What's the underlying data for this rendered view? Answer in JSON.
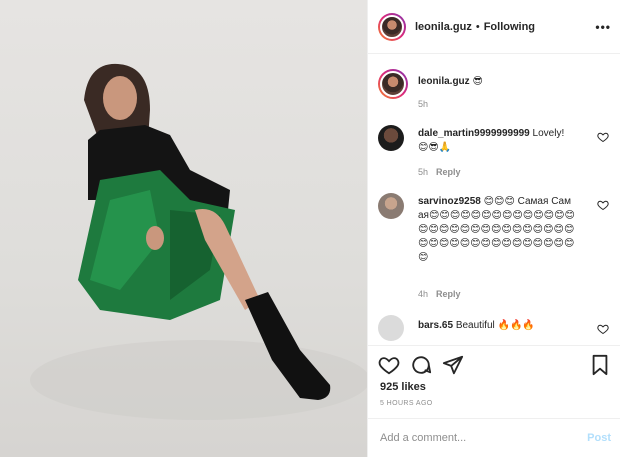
{
  "header": {
    "username": "leonila.guz",
    "dot": "•",
    "following": "Following",
    "more": "•••"
  },
  "caption": {
    "username": "leonila.guz",
    "text": "😎",
    "time": "5h"
  },
  "comments": [
    {
      "username": "dale_martin9999999999",
      "text": "Lovely!",
      "emojis": "😊😎🙏",
      "time": "5h",
      "reply": "Reply"
    },
    {
      "username": "sarvinoz9258",
      "text": "😊😊😊 Самая Самая😊😊😊😊😊😊😊😊😊😊😊😊😊😊😊😊😊😊😊😊😊😊😊😊😊😊😊😊😊😊😊😊😊😊😊😊😊😊😊😊😊😊😊😊😊",
      "time": "4h",
      "reply": "Reply"
    },
    {
      "username": "bars.65",
      "text": "Beautiful 🔥🔥🔥"
    }
  ],
  "likes": "925 likes",
  "timestamp": "5 HOURS AGO",
  "add_comment": {
    "placeholder": "Add a comment...",
    "post_label": "Post"
  },
  "colors": {
    "post_disabled": "#b2dffc",
    "muted": "#8e8e8e",
    "text": "#262626"
  }
}
